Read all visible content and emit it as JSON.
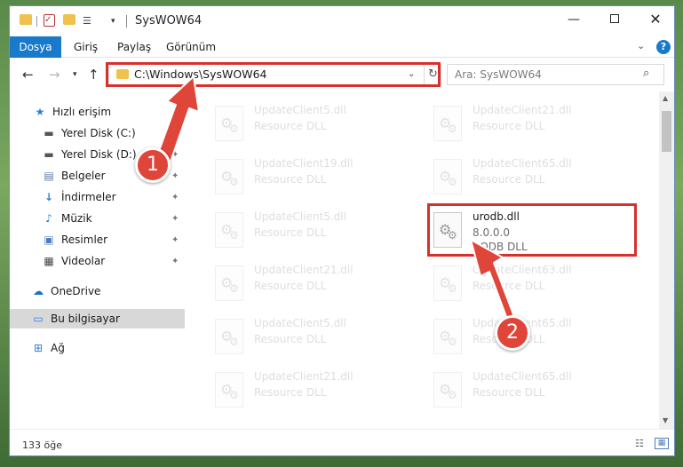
{
  "window": {
    "title": "SysWOW64",
    "minimize": "—",
    "close": "✕"
  },
  "quick_access_toolbar": {
    "check": "✓",
    "props": "☰",
    "dropdown": "▾"
  },
  "ribbon": {
    "tabs": [
      "Dosya",
      "Giriş",
      "Paylaş",
      "Görünüm"
    ],
    "expand": "⌄",
    "help": "?"
  },
  "nav_buttons": {
    "back": "←",
    "forward": "→",
    "recent": "▾",
    "up": "↑"
  },
  "address": {
    "path": "C:\\Windows\\SysWOW64",
    "dropdown": "⌄",
    "refresh": "↻"
  },
  "search": {
    "placeholder": "Ara: SysWOW64",
    "icon": "⌕"
  },
  "navpane": {
    "quick_access": "Hızlı erişim",
    "items": [
      {
        "label": "Yerel Disk (C:)",
        "icon": "drive-icon",
        "glyph": "▬"
      },
      {
        "label": "Yerel Disk (D:)",
        "icon": "drive-icon",
        "glyph": "▬"
      },
      {
        "label": "Belgeler",
        "icon": "documents-icon",
        "glyph": "▤"
      },
      {
        "label": "İndirmeler",
        "icon": "downloads-icon",
        "glyph": "↓"
      },
      {
        "label": "Müzik",
        "icon": "music-icon",
        "glyph": "♪"
      },
      {
        "label": "Resimler",
        "icon": "pictures-icon",
        "glyph": "▣"
      },
      {
        "label": "Videolar",
        "icon": "videos-icon",
        "glyph": "▦"
      }
    ],
    "pin": "✦",
    "onedrive": "OneDrive",
    "this_pc": "Bu bilgisayar",
    "network": "Ağ"
  },
  "files": [
    {
      "name": "UpdateClient5.dll",
      "type": "Resource DLL",
      "faded": true
    },
    {
      "name": "UpdateClient21.dll",
      "type": "Resource DLL",
      "faded": true
    },
    {
      "name": "UpdateClient19.dll",
      "type": "Resource DLL",
      "faded": true
    },
    {
      "name": "UpdateClient65.dll",
      "type": "Resource DLL",
      "faded": true
    },
    {
      "name": "UpdateClient5.dll",
      "type": "Resource DLL",
      "faded": true
    },
    {
      "name": "urodb.dll",
      "version": "8.0.0.0",
      "type": "RODB DLL",
      "faded": false
    },
    {
      "name": "UpdateClient21.dll",
      "type": "Resource DLL",
      "faded": true
    },
    {
      "name": "UpdateClient63.dll",
      "type": "Resource DLL",
      "faded": true
    },
    {
      "name": "UpdateClient5.dll",
      "type": "Resource DLL",
      "faded": true
    },
    {
      "name": "UpdateClient65.dll",
      "type": "Resource DLL",
      "faded": true
    },
    {
      "name": "UpdateClient21.dll",
      "type": "Resource DLL",
      "faded": true
    },
    {
      "name": "UpdateClient65.dll",
      "type": "Resource DLL",
      "faded": true
    }
  ],
  "statusbar": {
    "count": "133 öğe"
  },
  "annotations": {
    "badge1": "1",
    "badge2": "2",
    "color": "#e0453a"
  }
}
